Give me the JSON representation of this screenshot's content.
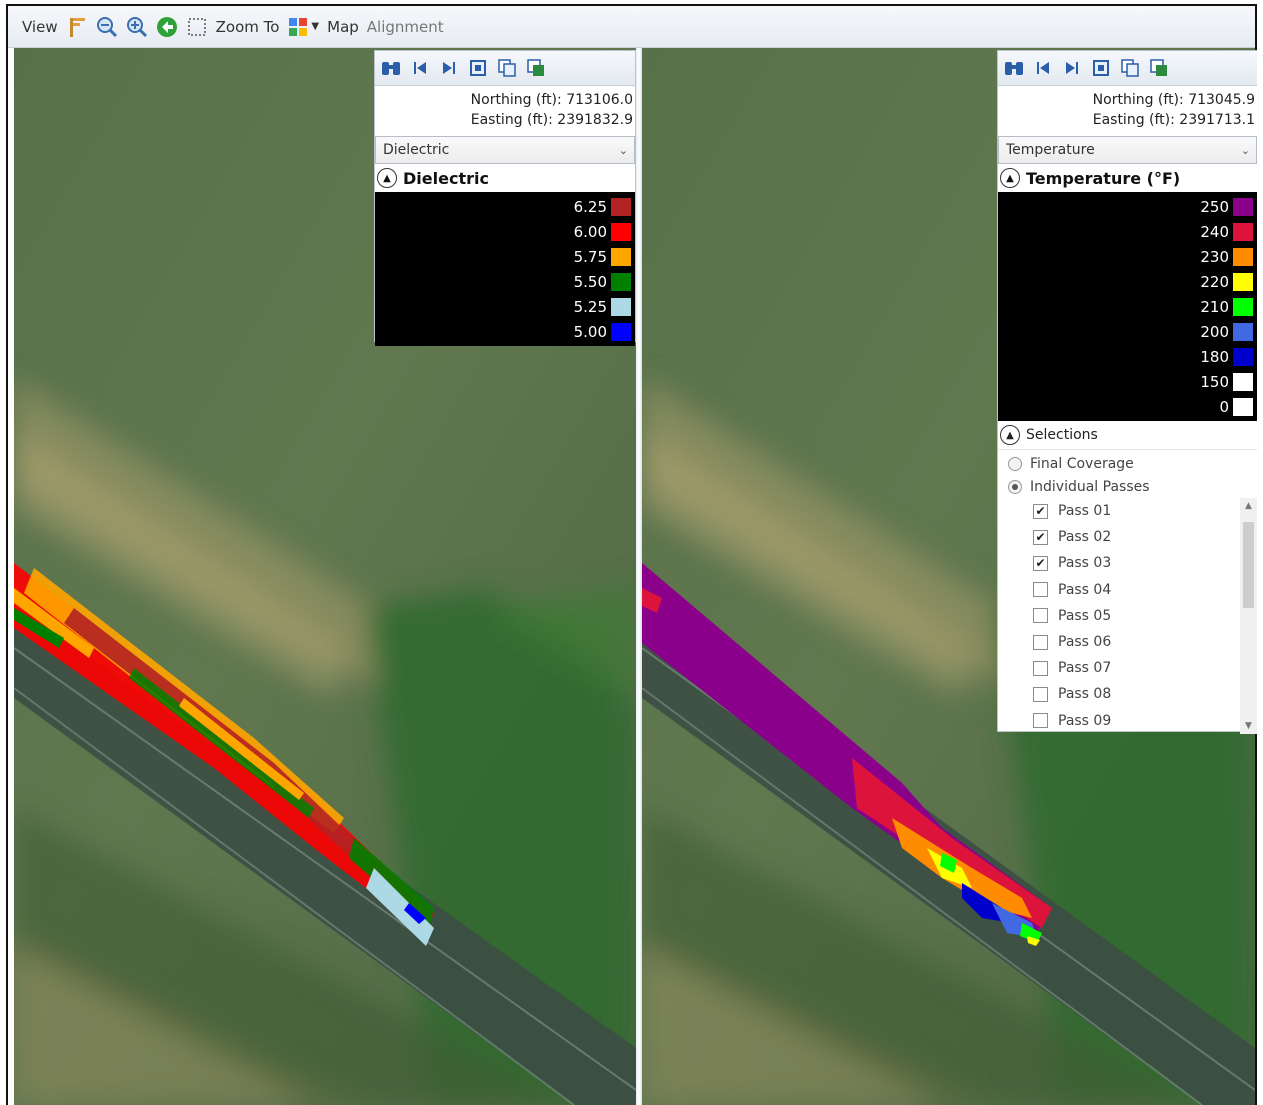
{
  "toolbar": {
    "view": "View",
    "zoom_to": "Zoom To",
    "map": "Map",
    "alignment": "Alignment"
  },
  "left_panel": {
    "northing": "Northing (ft): 713106.0",
    "easting": "Easting (ft): 2391832.9",
    "selected_layer": "Dielectric",
    "legend_title": "Dielectric",
    "legend": [
      {
        "value": "6.25",
        "color": "#b22222"
      },
      {
        "value": "6.00",
        "color": "#ff0000"
      },
      {
        "value": "5.75",
        "color": "#ffa500"
      },
      {
        "value": "5.50",
        "color": "#008000"
      },
      {
        "value": "5.25",
        "color": "#add8e6"
      },
      {
        "value": "5.00",
        "color": "#0000ff"
      }
    ]
  },
  "right_panel": {
    "northing": "Northing (ft): 713045.9",
    "easting": "Easting (ft): 2391713.1",
    "selected_layer": "Temperature",
    "legend_title": "Temperature (°F)",
    "legend": [
      {
        "value": "250",
        "color": "#8b008b"
      },
      {
        "value": "240",
        "color": "#dc143c"
      },
      {
        "value": "230",
        "color": "#ff8c00"
      },
      {
        "value": "220",
        "color": "#ffff00"
      },
      {
        "value": "210",
        "color": "#00ff00"
      },
      {
        "value": "200",
        "color": "#4169e1"
      },
      {
        "value": "180",
        "color": "#0000cd"
      },
      {
        "value": "150",
        "color": "#ffffff"
      },
      {
        "value": "0",
        "color": "#ffffff"
      }
    ],
    "selections_title": "Selections",
    "modes": [
      {
        "label": "Final Coverage",
        "selected": false
      },
      {
        "label": "Individual Passes",
        "selected": true
      }
    ],
    "passes": [
      {
        "label": "Pass 01",
        "checked": true
      },
      {
        "label": "Pass 02",
        "checked": true
      },
      {
        "label": "Pass 03",
        "checked": true
      },
      {
        "label": "Pass 04",
        "checked": false
      },
      {
        "label": "Pass 05",
        "checked": false
      },
      {
        "label": "Pass 06",
        "checked": false
      },
      {
        "label": "Pass 07",
        "checked": false
      },
      {
        "label": "Pass 08",
        "checked": false
      },
      {
        "label": "Pass 09",
        "checked": false
      }
    ]
  }
}
